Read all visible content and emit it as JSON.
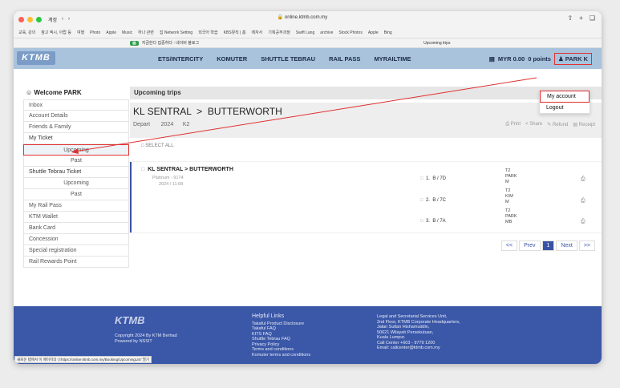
{
  "browser": {
    "url": "online.ktmb.com.my",
    "tab_group": "계정 ",
    "current_tab": "Upcoming trips",
    "sidebar_label": "지금한다 집중하다 : 네이버 블로그",
    "bookmarks": [
      "교육, 강의",
      "참고 엑시, 아랍 등",
      "여행",
      "Photo",
      "Apple",
      "Music",
      "하나 관련",
      "집 Network Setting",
      "외국어 학습",
      "KBS뮤직 | 홈",
      "에자서",
      "기획공부과정",
      "Swift Lang",
      "archive",
      "Stock Photos",
      "Apple",
      "Bing"
    ],
    "status_url": "새로운 탭에서 이 페이지의 ②https://online.ktmb.com.my/Booking/UpcomingList' 열기"
  },
  "nav": {
    "logo": "KTMB",
    "links": [
      "ETS/INTERCITY",
      "KOMUTER",
      "SHUTTLE TEBRAU",
      "RAIL PASS",
      "MYRAILTIME"
    ],
    "wallet": "MYR 0.00",
    "points": "0 points",
    "user": "PARK K"
  },
  "dropdown": {
    "account": "My account",
    "logout": "Logout"
  },
  "sidebar": {
    "welcome": "Welcome PARK",
    "items": {
      "inbox": "Inbox",
      "account": "Account Details",
      "friends": "Friends & Family",
      "myticket": "My Ticket",
      "upcoming": "Upcoming",
      "past": "Past",
      "shuttle": "Shuttle Tebrau Ticket",
      "shuttle_upcoming": "Upcoming",
      "shuttle_past": "Past",
      "railpass": "My Rail Pass",
      "wallet": "KTM Wallet",
      "bank": "Bank Card",
      "concession": "Concession",
      "special": "Special registration",
      "rewards": "Rail Rewards Point"
    }
  },
  "main": {
    "page_title": "Upcoming trips",
    "route_from": "KL SENTRAL",
    "route_to": "BUTTERWORTH",
    "depart_label": "Depart",
    "depart_year": "2024",
    "depart_code": "K2",
    "actions": [
      "Print",
      "Share",
      "Refund",
      "Receipt"
    ],
    "select_all": "SELECT ALL"
  },
  "trip": {
    "route": "KL SENTRAL  >  BUTTERWORTH",
    "class": "Platinum - 9174",
    "datetime": "2024 / 11:08",
    "passengers": [
      {
        "no": "1.",
        "seat": "B / 7D",
        "name1": "T2",
        "name2": "PARK",
        "name3": "M"
      },
      {
        "no": "2.",
        "seat": "B / 7C",
        "name1": "T2",
        "name2": "KIM",
        "name3": "M"
      },
      {
        "no": "3.",
        "seat": "B / 7A",
        "name1": "T2",
        "name2": "PARK",
        "name3": "MB"
      }
    ]
  },
  "pager": {
    "first": "<<",
    "prev": "Prev",
    "current": "1",
    "next": "Next",
    "last": ">>"
  },
  "footer": {
    "copyright": "Copyright 2024 By KTM Berhad",
    "powered": "Powered by NSSIT",
    "help_title": "Helpful Links",
    "help_links": [
      "Takaful Product Disclosure",
      "Takaful FAQ",
      "KITS FAQ",
      "Shuttle Tebrau FAQ",
      "Privacy Policy",
      "Terms and conditions",
      "Komuter terms and conditions"
    ],
    "contact": [
      "Legal and Secretarial Services Unit,",
      "2nd Floor, KTMB Corporate Headquarters,",
      "Jalan Sultan Hishamuddin,",
      "50621 Wilayah Persekutuan,",
      "Kuala Lumpur.",
      "Call Center +603 - 9779 1200",
      "Email: callcenter@ktmb.com.my"
    ]
  },
  "colors": {
    "accent": "#3a52a6",
    "nav_bg": "#a9c3dd",
    "highlight": "#e03030"
  }
}
